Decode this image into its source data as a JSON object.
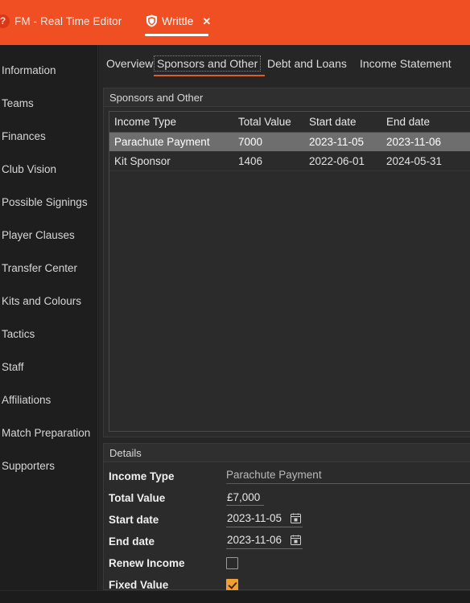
{
  "titlebar": {
    "app_title": "FM - Real Time Editor",
    "help_icon": "question-mark-icon",
    "cutoff_text": "",
    "club_tab": {
      "label": "Writtle",
      "icon": "shield-icon",
      "close_label": "✕"
    },
    "accent_color": "#f04e23"
  },
  "sidebar": {
    "items": [
      {
        "label": "Information"
      },
      {
        "label": "Teams"
      },
      {
        "label": "Finances"
      },
      {
        "label": "Club Vision"
      },
      {
        "label": "Possible Signings"
      },
      {
        "label": "Player Clauses"
      },
      {
        "label": "Transfer Center"
      },
      {
        "label": "Kits and Colours"
      },
      {
        "label": "Tactics"
      },
      {
        "label": "Staff"
      },
      {
        "label": "Affiliations"
      },
      {
        "label": "Match Preparation"
      },
      {
        "label": "Supporters"
      }
    ]
  },
  "tabs": [
    {
      "label": "Overview",
      "selected": false
    },
    {
      "label": "Sponsors and Other",
      "selected": true
    },
    {
      "label": "Debt and Loans",
      "selected": false
    },
    {
      "label": "Income Statement",
      "selected": false
    }
  ],
  "sponsors_panel": {
    "title": "Sponsors and Other",
    "columns": [
      "Income Type",
      "Total Value",
      "Start date",
      "End date"
    ],
    "rows": [
      {
        "income_type": "Parachute Payment",
        "total_value": "7000",
        "start_date": "2023-11-05",
        "end_date": "2023-11-06",
        "selected": true
      },
      {
        "income_type": "Kit Sponsor",
        "total_value": "1406",
        "start_date": "2022-06-01",
        "end_date": "2024-05-31",
        "selected": false
      }
    ]
  },
  "details_panel": {
    "title": "Details",
    "fields": {
      "income_type_label": "Income Type",
      "income_type_value": "Parachute Payment",
      "total_value_label": "Total Value",
      "total_value_value": "£7,000",
      "start_date_label": "Start date",
      "start_date_value": "2023-11-05",
      "end_date_label": "End date",
      "end_date_value": "2023-11-06",
      "renew_income_label": "Renew Income",
      "renew_income_checked": false,
      "fixed_value_label": "Fixed Value",
      "fixed_value_checked": true
    },
    "checkbox_accent": "#f0a030"
  }
}
